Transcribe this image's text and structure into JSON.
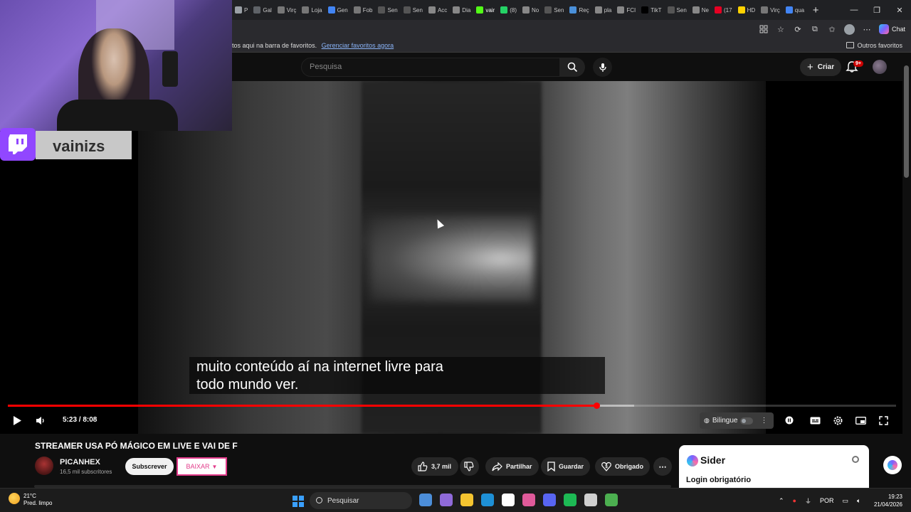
{
  "browser": {
    "tabs": [
      {
        "label": "P",
        "fav": "#9aa0a6"
      },
      {
        "label": "Gal",
        "fav": "#5f6368"
      },
      {
        "label": "Virç",
        "fav": "#777"
      },
      {
        "label": "Loja",
        "fav": "#777"
      },
      {
        "label": "Gen",
        "fav": "#4285f4"
      },
      {
        "label": "Fob",
        "fav": "#777"
      },
      {
        "label": "Sen",
        "fav": "#555"
      },
      {
        "label": "Sen",
        "fav": "#555"
      },
      {
        "label": "Acc",
        "fav": "#888"
      },
      {
        "label": "Dia",
        "fav": "#888"
      },
      {
        "label": "vair",
        "fav": "#53fc18",
        "active": true
      },
      {
        "label": "(8)",
        "fav": "#25d366"
      },
      {
        "label": "No",
        "fav": "#888"
      },
      {
        "label": "Sen",
        "fav": "#555"
      },
      {
        "label": "Reç",
        "fav": "#4a90d9"
      },
      {
        "label": "pla",
        "fav": "#888"
      },
      {
        "label": "FCI",
        "fav": "#888"
      },
      {
        "label": "TikT",
        "fav": "#000"
      },
      {
        "label": "Sen",
        "fav": "#555"
      },
      {
        "label": "Ne",
        "fav": "#888"
      },
      {
        "label": "(17",
        "fav": "#e60023"
      },
      {
        "label": "HD",
        "fav": "#ffd200"
      },
      {
        "label": "Virç",
        "fav": "#777"
      },
      {
        "label": "qua",
        "fav": "#4285f4"
      }
    ],
    "new_tab": "+",
    "window_controls": {
      "minimize": "—",
      "maximize": "❐",
      "close": "✕"
    },
    "copilot_label": "Chat",
    "favorites_msg": "tos aqui na barra de favoritos.",
    "favorites_link": "Gerenciar favoritos agora",
    "other_favorites": "Outros favoritos"
  },
  "youtube": {
    "search_placeholder": "Pesquisa",
    "create_label": "Criar",
    "notification_badge": "9+",
    "caption_line1": "muito conteúdo aí na internet livre para",
    "caption_line2": "todo mundo ver.",
    "time_display": "5:23 / 8:08",
    "progress": {
      "played_pct": 66.3,
      "buffered_pct": 70.5
    },
    "bilingue_label": "Bilingue",
    "video_title": "STREAMER USA PÓ MÁGICO EM LIVE E VAI DE F",
    "channel_name": "PICANHEX",
    "subscribers": "16,5 mil subscritores",
    "subscribe_label": "Subscrever",
    "baixar_label": "BAIXAR",
    "likes": "3,7 mil",
    "share_label": "Partilhar",
    "save_label": "Guardar",
    "thanks_label": "Obrigado"
  },
  "overlay": {
    "streamer_name": "vainizs"
  },
  "sider": {
    "name": "Sider",
    "subtitle": "Login obrigatório"
  },
  "taskbar": {
    "temperature": "21°C",
    "weather": "Pred. limpo",
    "search_label": "Pesquisar",
    "language": "POR",
    "time": "19:23",
    "date": "21/04/2026",
    "app_colors": [
      "#4c8ed9",
      "#8f6ad9",
      "#f4c430",
      "#1e90d6",
      "#ffffff",
      "#e05a9a",
      "#5865f2",
      "#1db954",
      "#cfcfcf",
      "#4caf50"
    ]
  }
}
